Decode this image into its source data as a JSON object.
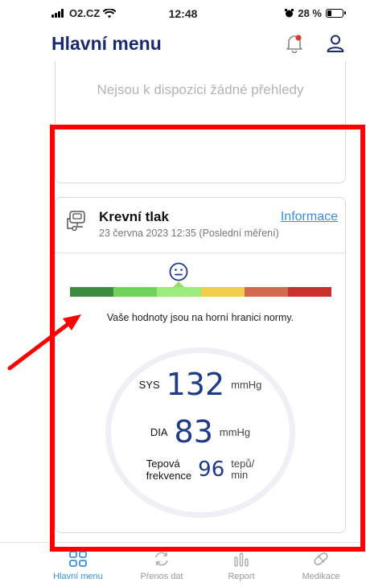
{
  "status_bar": {
    "carrier": "O2.CZ",
    "time": "12:48",
    "battery": "28 %"
  },
  "header": {
    "title": "Hlavní menu"
  },
  "overview": {
    "empty_text": "Nejsou k dispozici žádné přehledy"
  },
  "blood_pressure": {
    "title": "Krevní tlak",
    "date": "23 června 2023 12:35 (Poslední měření)",
    "info_link": "Informace",
    "scale_colors": [
      "#3d8c40",
      "#6fd35b",
      "#9aec7c",
      "#f1cf4a",
      "#d26a4f",
      "#c9302c"
    ],
    "scale_active_segment": 3,
    "message": "Vaše hodnoty jsou na horní hranici normy.",
    "sys": {
      "label": "SYS",
      "value": "132",
      "unit": "mmHg"
    },
    "dia": {
      "label": "DIA",
      "value": "83",
      "unit": "mmHg"
    },
    "pulse": {
      "label_line1": "Tepová",
      "label_line2": "frekvence",
      "value": "96",
      "unit_line1": "tepů/",
      "unit_line2": "min"
    }
  },
  "tabs": [
    {
      "label": "Hlavní menu",
      "icon": "grid-icon",
      "active": true
    },
    {
      "label": "Přenos dat",
      "icon": "sync-icon",
      "active": false
    },
    {
      "label": "Report",
      "icon": "chart-icon",
      "active": false
    },
    {
      "label": "Medikace",
      "icon": "pill-icon",
      "active": false
    }
  ],
  "colors": {
    "title": "#1a2b6d",
    "accent": "#3c8fd8",
    "value": "#1e3a8a",
    "annotation": "#ff0000"
  }
}
